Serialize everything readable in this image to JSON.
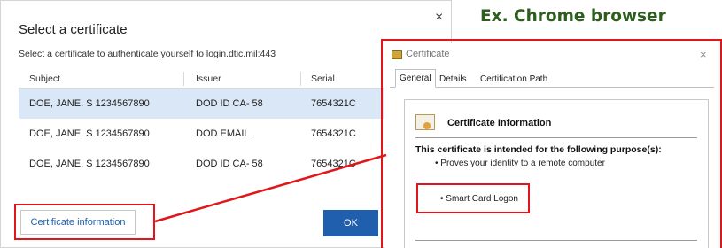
{
  "select_dialog": {
    "title": "Select a certificate",
    "close_glyph": "×",
    "subtitle": "Select a certificate to authenticate yourself to login.dtic.mil:443",
    "columns": [
      "Subject",
      "Issuer",
      "Serial"
    ],
    "rows": [
      {
        "subject": "DOE, JANE. S 1234567890",
        "issuer": "DOD ID CA- 58",
        "serial": "7654321C",
        "selected": true
      },
      {
        "subject": "DOE, JANE. S 1234567890",
        "issuer": "DOD EMAIL",
        "serial": "7654321C",
        "selected": false
      },
      {
        "subject": "DOE, JANE. S 1234567890",
        "issuer": "DOD ID CA- 58",
        "serial": "7654321C",
        "selected": false
      }
    ],
    "cert_info_button": "Certificate information",
    "ok_button": "OK"
  },
  "annotation": "Ex. Chrome browser",
  "certificate_window": {
    "title": "Certificate",
    "close_glyph": "×",
    "tabs": [
      "General",
      "Details",
      "Certification Path"
    ],
    "active_tab": "General",
    "info_title": "Certificate Information",
    "purpose_heading": "This certificate is intended for the following purpose(s):",
    "purposes": [
      "• Proves your identity to a remote computer",
      "• Smart Card Logon"
    ]
  },
  "colors": {
    "highlight": "#e0161b",
    "annotation": "#2d5e1e",
    "selected_row": "#d9e7f6",
    "ok_button": "#1f5fae",
    "link_text": "#1a5fae"
  },
  "icons": [
    "close-icon",
    "certificate-icon",
    "certificate-info-icon"
  ]
}
